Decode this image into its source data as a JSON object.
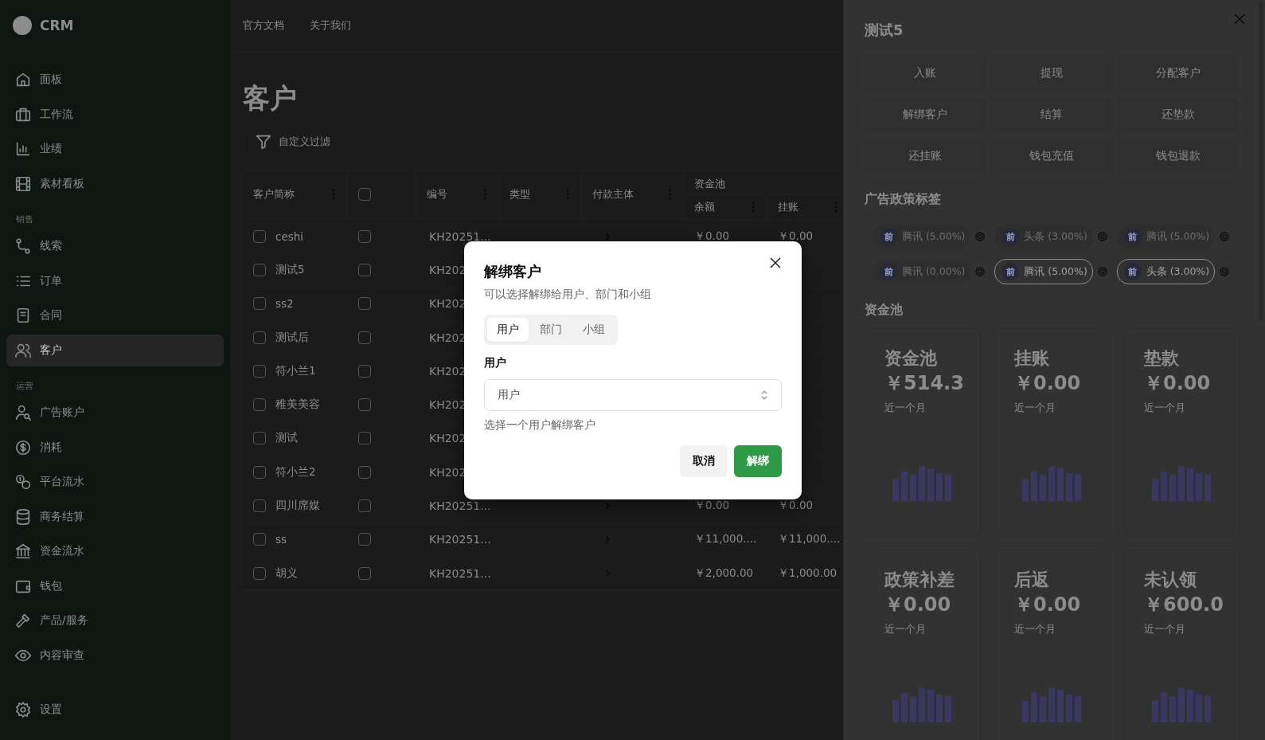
{
  "sidebar": {
    "logo_text": "CRM",
    "groups": [
      {
        "items": [
          {
            "label": "面板",
            "selected": false
          },
          {
            "label": "工作流",
            "selected": false
          },
          {
            "label": "业绩",
            "selected": false
          },
          {
            "label": "素材看板",
            "selected": false
          }
        ]
      },
      {
        "label": "销售",
        "items": [
          {
            "label": "线索",
            "selected": false
          },
          {
            "label": "订单",
            "selected": false
          },
          {
            "label": "合同",
            "selected": false
          },
          {
            "label": "客户",
            "selected": true
          }
        ]
      },
      {
        "label": "运营",
        "items": [
          {
            "label": "广告账户",
            "selected": false
          },
          {
            "label": "消耗",
            "selected": false
          },
          {
            "label": "平台流水",
            "selected": false
          },
          {
            "label": "商务结算",
            "selected": false
          },
          {
            "label": "资金流水",
            "selected": false
          },
          {
            "label": "钱包",
            "selected": false
          },
          {
            "label": "产品/服务",
            "selected": false
          },
          {
            "label": "内容审查",
            "selected": false
          }
        ]
      }
    ],
    "footer_item": {
      "label": "设置",
      "selected": false
    }
  },
  "top_nav": [
    "官方文档",
    "关于我们"
  ],
  "page": {
    "title": "客户",
    "filter_button": "自定义过滤"
  },
  "table": {
    "columns": [
      "客户简称",
      "",
      "编号",
      "类型",
      "付款主体"
    ],
    "group_header": {
      "label": "资金池",
      "columns": [
        "余额",
        "挂账"
      ]
    },
    "select_all": {
      "checked": false
    },
    "rows": [
      {
        "name": "ceshi",
        "checked": false,
        "code": "KH20251...",
        "expand_icon": true,
        "balance": "￥0.00",
        "hangup": "￥0.00"
      },
      {
        "name": "测试5",
        "checked": false,
        "code": "KH202"
      },
      {
        "name": "ss2",
        "checked": false,
        "code": "KH202"
      },
      {
        "name": "测试后",
        "checked": false,
        "code": "KH202"
      },
      {
        "name": "符小兰1",
        "checked": false,
        "code": "KH202"
      },
      {
        "name": "稚美美容",
        "checked": false,
        "code": "KH202"
      },
      {
        "name": "测试",
        "checked": false,
        "code": "KH202"
      },
      {
        "name": "符小兰2",
        "checked": false,
        "code": "KH202"
      },
      {
        "name": "四川席媒",
        "checked": false,
        "code": "KH20251...",
        "expand_icon": true,
        "balance": "￥0.00",
        "hangup": "￥0.00"
      },
      {
        "name": "ss",
        "checked": false,
        "code": "KH20251...",
        "expand_icon": true,
        "balance": "￥11,000....",
        "hangup": "￥11,000...."
      },
      {
        "name": "胡义",
        "checked": false,
        "code": "KH20251...",
        "expand_icon": true,
        "balance": "￥2,000.00",
        "hangup": "￥1,000.00"
      }
    ]
  },
  "detail_panel": {
    "title": "测试5",
    "actions": [
      "入账",
      "提现",
      "分配客户",
      "解绑客户",
      "结算",
      "还垫款",
      "还挂账",
      "钱包充值",
      "钱包退款"
    ],
    "tags_title": "广告政策标签",
    "tags": [
      {
        "badge": "前",
        "label": "腾讯 (5.00%)",
        "disabled": true
      },
      {
        "badge": "前",
        "label": "头条 (3.00%)",
        "disabled": true
      },
      {
        "badge": "前",
        "label": "腾讯 (5.00%)",
        "disabled": true
      },
      {
        "badge": "前",
        "label": "腾讯 (0.00%)",
        "disabled": true
      },
      {
        "badge": "前",
        "label": "腾讯 (5.00%)",
        "disabled": false
      },
      {
        "badge": "前",
        "label": "头条 (3.00%)",
        "disabled": false
      }
    ],
    "funds_title": "资金池",
    "cards": [
      {
        "title": "资金池",
        "amount": "￥514.3",
        "caption": "近一个月"
      },
      {
        "title": "挂账",
        "amount": "￥0.00",
        "caption": "近一个月"
      },
      {
        "title": "垫款",
        "amount": "￥0.00",
        "caption": "近一个月"
      },
      {
        "title": "政策补差",
        "amount": "￥0.00",
        "caption": "近一个月"
      },
      {
        "title": "后返",
        "amount": "￥0.00",
        "caption": "近一个月"
      },
      {
        "title": "未认领",
        "amount": "￥600.0",
        "caption": "近一个月"
      }
    ]
  },
  "dialog": {
    "title": "解绑客户",
    "description": "可以选择解绑给用户、部门和小组",
    "tabs": [
      {
        "label": "用户",
        "selected": true
      },
      {
        "label": "部门",
        "selected": false
      },
      {
        "label": "小组",
        "selected": false
      }
    ],
    "field_label": "用户",
    "select_placeholder": "用户",
    "hint": "选择一个用户解绑客户",
    "cancel": "取消",
    "confirm": "解绑"
  }
}
